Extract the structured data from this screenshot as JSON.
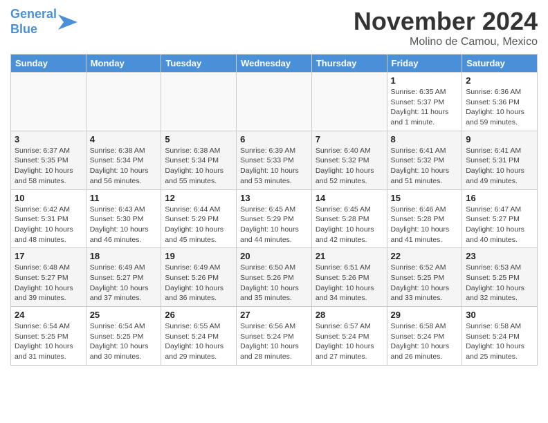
{
  "header": {
    "logo_line1": "General",
    "logo_line2": "Blue",
    "month_title": "November 2024",
    "subtitle": "Molino de Camou, Mexico"
  },
  "weekdays": [
    "Sunday",
    "Monday",
    "Tuesday",
    "Wednesday",
    "Thursday",
    "Friday",
    "Saturday"
  ],
  "weeks": [
    [
      {
        "num": "",
        "info": ""
      },
      {
        "num": "",
        "info": ""
      },
      {
        "num": "",
        "info": ""
      },
      {
        "num": "",
        "info": ""
      },
      {
        "num": "",
        "info": ""
      },
      {
        "num": "1",
        "info": "Sunrise: 6:35 AM\nSunset: 5:37 PM\nDaylight: 11 hours and 1 minute."
      },
      {
        "num": "2",
        "info": "Sunrise: 6:36 AM\nSunset: 5:36 PM\nDaylight: 10 hours and 59 minutes."
      }
    ],
    [
      {
        "num": "3",
        "info": "Sunrise: 6:37 AM\nSunset: 5:35 PM\nDaylight: 10 hours and 58 minutes."
      },
      {
        "num": "4",
        "info": "Sunrise: 6:38 AM\nSunset: 5:34 PM\nDaylight: 10 hours and 56 minutes."
      },
      {
        "num": "5",
        "info": "Sunrise: 6:38 AM\nSunset: 5:34 PM\nDaylight: 10 hours and 55 minutes."
      },
      {
        "num": "6",
        "info": "Sunrise: 6:39 AM\nSunset: 5:33 PM\nDaylight: 10 hours and 53 minutes."
      },
      {
        "num": "7",
        "info": "Sunrise: 6:40 AM\nSunset: 5:32 PM\nDaylight: 10 hours and 52 minutes."
      },
      {
        "num": "8",
        "info": "Sunrise: 6:41 AM\nSunset: 5:32 PM\nDaylight: 10 hours and 51 minutes."
      },
      {
        "num": "9",
        "info": "Sunrise: 6:41 AM\nSunset: 5:31 PM\nDaylight: 10 hours and 49 minutes."
      }
    ],
    [
      {
        "num": "10",
        "info": "Sunrise: 6:42 AM\nSunset: 5:31 PM\nDaylight: 10 hours and 48 minutes."
      },
      {
        "num": "11",
        "info": "Sunrise: 6:43 AM\nSunset: 5:30 PM\nDaylight: 10 hours and 46 minutes."
      },
      {
        "num": "12",
        "info": "Sunrise: 6:44 AM\nSunset: 5:29 PM\nDaylight: 10 hours and 45 minutes."
      },
      {
        "num": "13",
        "info": "Sunrise: 6:45 AM\nSunset: 5:29 PM\nDaylight: 10 hours and 44 minutes."
      },
      {
        "num": "14",
        "info": "Sunrise: 6:45 AM\nSunset: 5:28 PM\nDaylight: 10 hours and 42 minutes."
      },
      {
        "num": "15",
        "info": "Sunrise: 6:46 AM\nSunset: 5:28 PM\nDaylight: 10 hours and 41 minutes."
      },
      {
        "num": "16",
        "info": "Sunrise: 6:47 AM\nSunset: 5:27 PM\nDaylight: 10 hours and 40 minutes."
      }
    ],
    [
      {
        "num": "17",
        "info": "Sunrise: 6:48 AM\nSunset: 5:27 PM\nDaylight: 10 hours and 39 minutes."
      },
      {
        "num": "18",
        "info": "Sunrise: 6:49 AM\nSunset: 5:27 PM\nDaylight: 10 hours and 37 minutes."
      },
      {
        "num": "19",
        "info": "Sunrise: 6:49 AM\nSunset: 5:26 PM\nDaylight: 10 hours and 36 minutes."
      },
      {
        "num": "20",
        "info": "Sunrise: 6:50 AM\nSunset: 5:26 PM\nDaylight: 10 hours and 35 minutes."
      },
      {
        "num": "21",
        "info": "Sunrise: 6:51 AM\nSunset: 5:26 PM\nDaylight: 10 hours and 34 minutes."
      },
      {
        "num": "22",
        "info": "Sunrise: 6:52 AM\nSunset: 5:25 PM\nDaylight: 10 hours and 33 minutes."
      },
      {
        "num": "23",
        "info": "Sunrise: 6:53 AM\nSunset: 5:25 PM\nDaylight: 10 hours and 32 minutes."
      }
    ],
    [
      {
        "num": "24",
        "info": "Sunrise: 6:54 AM\nSunset: 5:25 PM\nDaylight: 10 hours and 31 minutes."
      },
      {
        "num": "25",
        "info": "Sunrise: 6:54 AM\nSunset: 5:25 PM\nDaylight: 10 hours and 30 minutes."
      },
      {
        "num": "26",
        "info": "Sunrise: 6:55 AM\nSunset: 5:24 PM\nDaylight: 10 hours and 29 minutes."
      },
      {
        "num": "27",
        "info": "Sunrise: 6:56 AM\nSunset: 5:24 PM\nDaylight: 10 hours and 28 minutes."
      },
      {
        "num": "28",
        "info": "Sunrise: 6:57 AM\nSunset: 5:24 PM\nDaylight: 10 hours and 27 minutes."
      },
      {
        "num": "29",
        "info": "Sunrise: 6:58 AM\nSunset: 5:24 PM\nDaylight: 10 hours and 26 minutes."
      },
      {
        "num": "30",
        "info": "Sunrise: 6:58 AM\nSunset: 5:24 PM\nDaylight: 10 hours and 25 minutes."
      }
    ]
  ]
}
